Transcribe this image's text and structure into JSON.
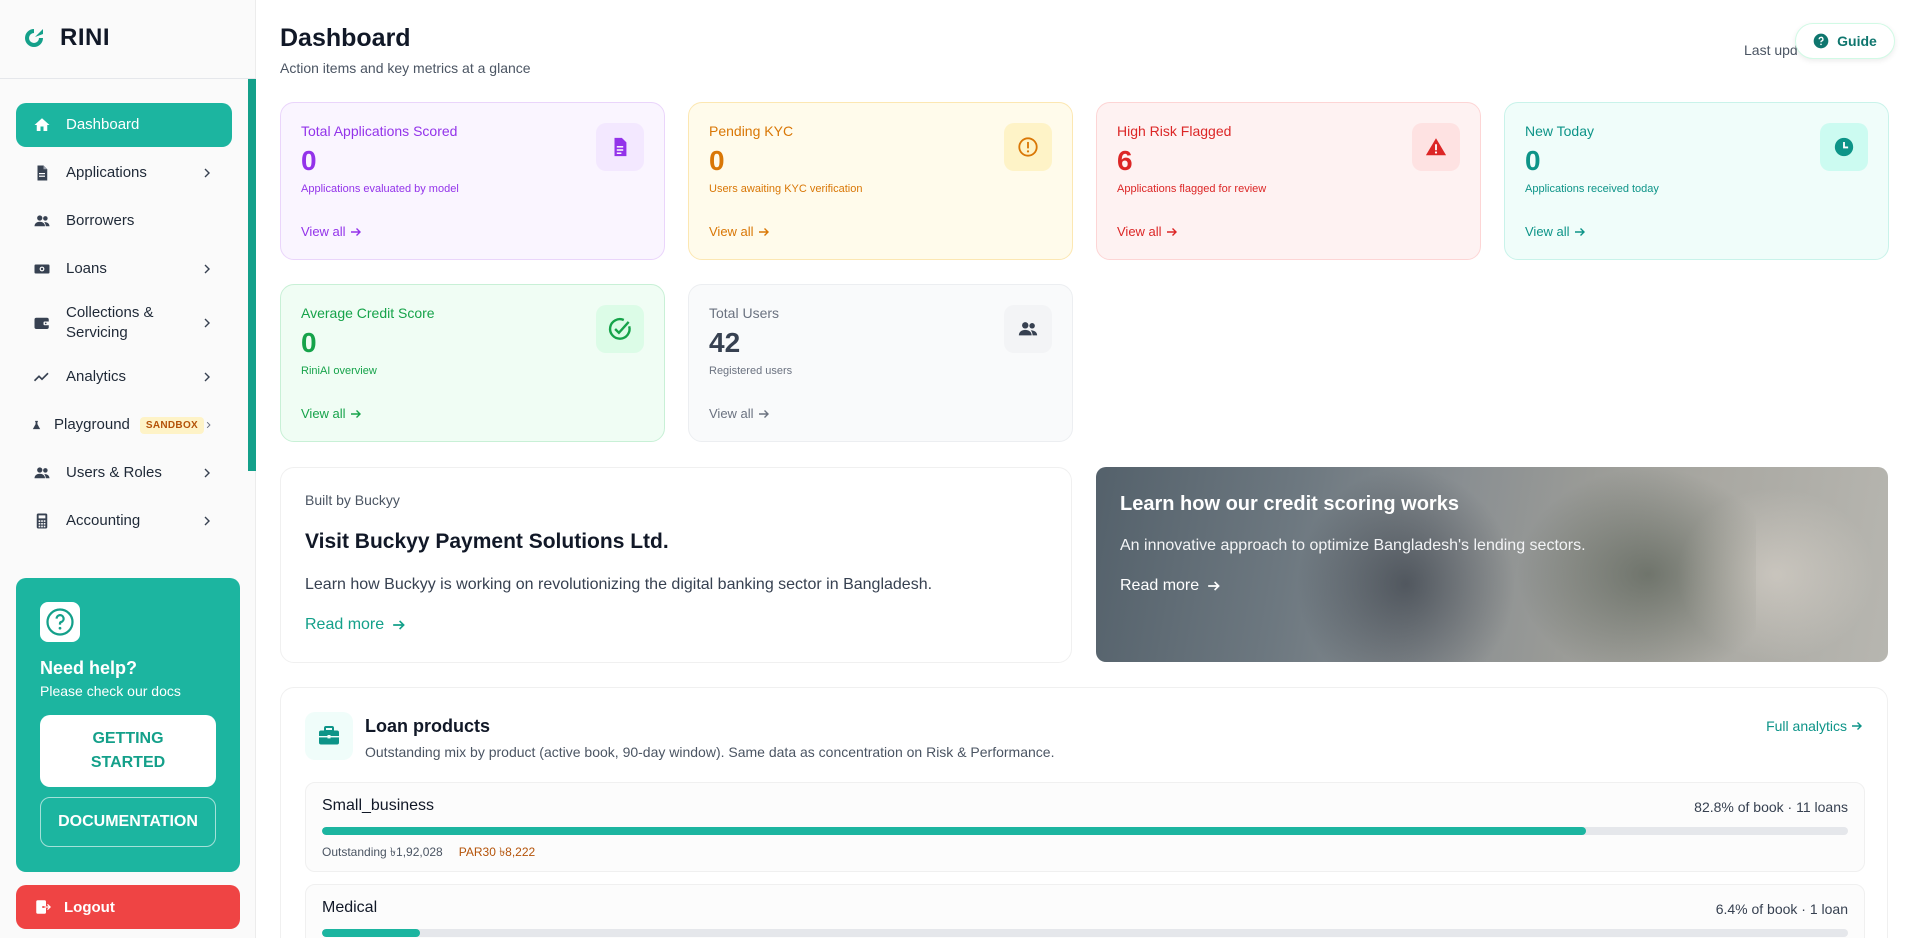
{
  "brand": {
    "name": "RINI"
  },
  "sidebar": {
    "items": [
      {
        "label": "Dashboard",
        "icon": "home-icon",
        "active": true,
        "chevron": false
      },
      {
        "label": "Applications",
        "icon": "document-icon",
        "chevron": true
      },
      {
        "label": "Borrowers",
        "icon": "users-icon",
        "chevron": false
      },
      {
        "label": "Loans",
        "icon": "money-icon",
        "chevron": true
      },
      {
        "label": "Collections & Servicing",
        "icon": "wallet-icon",
        "chevron": true
      },
      {
        "label": "Analytics",
        "icon": "trend-icon",
        "chevron": true
      },
      {
        "label": "Playground",
        "icon": "flask-icon",
        "chevron": true,
        "badge": "SANDBOX"
      },
      {
        "label": "Users & Roles",
        "icon": "users-roles-icon",
        "chevron": true
      },
      {
        "label": "Accounting",
        "icon": "calculator-icon",
        "chevron": true
      }
    ],
    "help": {
      "title": "Need help?",
      "subtitle": "Please check our docs",
      "getting_started": "GETTING STARTED",
      "documentation": "DOCUMENTATION"
    },
    "logout": "Logout"
  },
  "header": {
    "title": "Dashboard",
    "subtitle": "Action items and key metrics at a glance",
    "last_updated": "Last upd",
    "guide": "Guide"
  },
  "stats": [
    {
      "label": "Total Applications Scored",
      "value": "0",
      "desc": "Applications evaluated by model",
      "link": "View all",
      "icon": "document-icon"
    },
    {
      "label": "Pending KYC",
      "value": "0",
      "desc": "Users awaiting KYC verification",
      "link": "View all",
      "icon": "alert-circle-icon"
    },
    {
      "label": "High Risk Flagged",
      "value": "6",
      "desc": "Applications flagged for review",
      "link": "View all",
      "icon": "warning-icon"
    },
    {
      "label": "New Today",
      "value": "0",
      "desc": "Applications received today",
      "link": "View all",
      "icon": "clock-icon"
    },
    {
      "label": "Average Credit Score",
      "value": "0",
      "desc": "RiniAI overview",
      "link": "View all",
      "icon": "check-circle-icon"
    },
    {
      "label": "Total Users",
      "value": "42",
      "desc": "Registered users",
      "link": "View all",
      "icon": "users-icon"
    }
  ],
  "promo": {
    "overline": "Built by Buckyy",
    "title": "Visit Buckyy Payment Solutions Ltd.",
    "text": "Learn how Buckyy is working on revolutionizing the digital banking sector in Bangladesh.",
    "link": "Read more"
  },
  "hero": {
    "title": "Learn how our credit scoring works",
    "text": "An innovative approach to optimize Bangladesh's lending sectors.",
    "link": "Read more"
  },
  "loan_products": {
    "title": "Loan products",
    "subtitle": "Outstanding mix by product (active book, 90-day window). Same data as concentration on Risk & Performance.",
    "full_analytics": "Full analytics",
    "products": [
      {
        "name": "Small_business",
        "share": "82.8% of book · 11 loans",
        "fill": 0.828,
        "outstanding": "Outstanding ৳1,92,028",
        "par": "PAR30 ৳8,222"
      },
      {
        "name": "Medical",
        "share": "6.4% of book · 1 loan",
        "fill": 0.064
      }
    ]
  },
  "colors": {
    "accent": "#1cb5a0",
    "danger": "#ef4444"
  }
}
